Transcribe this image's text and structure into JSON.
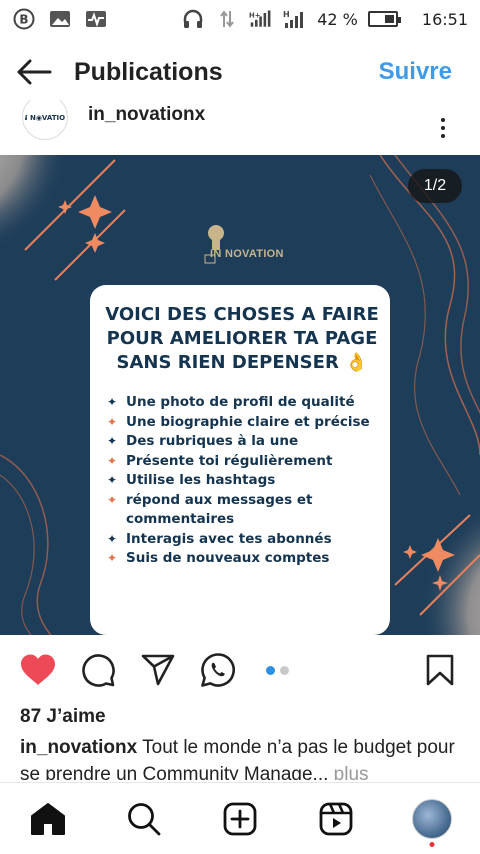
{
  "status_bar": {
    "battery": "42 %",
    "battery_level": 0.42,
    "time": "16:51",
    "left_icons": [
      "b-badge-icon",
      "gallery-icon",
      "activity-icon"
    ],
    "right_icons": [
      "headphones-icon",
      "data-transfer-icon",
      "signal-icon",
      "signal-icon",
      "battery-icon"
    ]
  },
  "header": {
    "title": "Publications",
    "follow_label": "Suivre"
  },
  "post": {
    "author": "in_novationx",
    "page_indicator": "1/2",
    "image": {
      "brand": "IN NOVATION",
      "card_title": "VOICI DES CHOSES A FAIRE POUR AMELIORER TA PAGE SANS RIEN DEPENSER 👌",
      "items": [
        "Une photo de profil de qualité",
        "Une biographie claire et précise",
        "Des rubriques à la une",
        "Présente toi régulièrement",
        "Utilise les hashtags",
        "répond aux messages et commentaires",
        "Interagis avec tes abonnés",
        "Suis de nouveaux comptes"
      ]
    },
    "likes": "87 J’aime",
    "caption_author": "in_novationx",
    "caption_text": " Tout le monde n’a pas le budget pour se prendre un Community  Manage...",
    "caption_more": " plus",
    "carousel": {
      "count": 2,
      "active": 0
    }
  },
  "colors": {
    "accent": "#3f9ae8",
    "like": "#ed4956",
    "image_bg": "#1d3d59",
    "card_text": "#14344f"
  }
}
